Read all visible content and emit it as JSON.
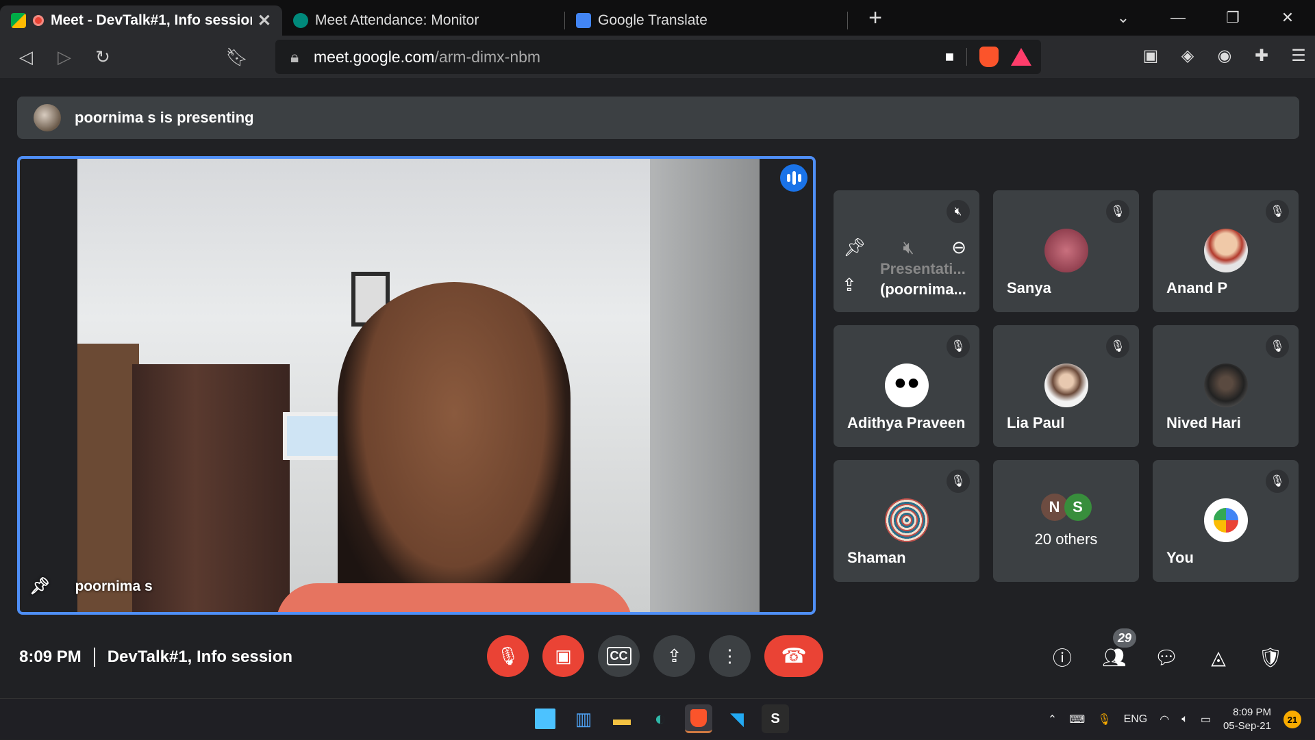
{
  "browser": {
    "tabs": [
      {
        "title": "Meet - DevTalk#1, Info session",
        "active": true
      },
      {
        "title": "Meet Attendance: Monitor",
        "active": false
      },
      {
        "title": "Google Translate",
        "active": false
      }
    ],
    "url_domain": "meet.google.com",
    "url_path": "/arm-dimx-nbm"
  },
  "banner": {
    "text": "poornima s is presenting"
  },
  "main_video": {
    "name": "poornima s"
  },
  "participants": [
    {
      "type": "presentation",
      "line1": "Presentati...",
      "line2": "(poornima..."
    },
    {
      "name": "Sanya",
      "avatar_color": "#8a3b4a"
    },
    {
      "name": "Anand P",
      "avatar_color": "#d8d8d8"
    },
    {
      "name": "Adithya Praveen",
      "avatar_color": "#ffffff"
    },
    {
      "name": "Lia Paul",
      "avatar_color": "#d9cbb8"
    },
    {
      "name": "Nived Hari",
      "avatar_color": "#3a3a3a"
    },
    {
      "name": "Shaman",
      "avatar_color": "#9aa9b5"
    },
    {
      "type": "others",
      "initials": [
        "N",
        "S"
      ],
      "label": "20 others"
    },
    {
      "name": "You",
      "avatar_color": "#ffffff"
    }
  ],
  "meeting": {
    "time": "8:09 PM",
    "title": "DevTalk#1, Info session"
  },
  "people_count": "29",
  "taskbar": {
    "lang": "ENG",
    "time": "8:09 PM",
    "date": "05-Sep-21",
    "notifications": "21"
  },
  "colors": {
    "accent": "#1a73e8",
    "danger": "#ea4335"
  }
}
